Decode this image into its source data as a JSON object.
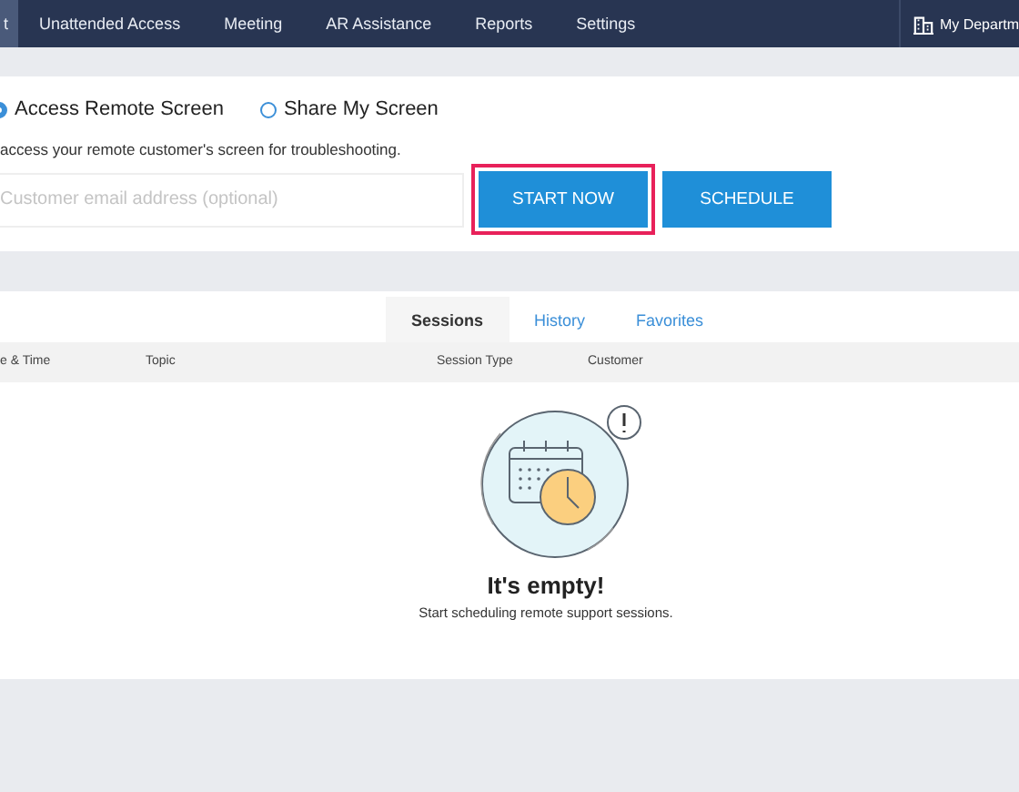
{
  "nav": {
    "items": [
      {
        "label": "t",
        "selected": true
      },
      {
        "label": "Unattended Access",
        "selected": false
      },
      {
        "label": "Meeting",
        "selected": false
      },
      {
        "label": "AR Assistance",
        "selected": false
      },
      {
        "label": "Reports",
        "selected": false
      },
      {
        "label": "Settings",
        "selected": false
      }
    ],
    "department": "My Departm"
  },
  "mode": {
    "options": [
      {
        "label": "Access Remote Screen",
        "selected": true
      },
      {
        "label": "Share My Screen",
        "selected": false
      }
    ],
    "description": "access your remote customer's screen for troubleshooting.",
    "email": {
      "placeholder": "Customer email address (optional)"
    },
    "buttons": [
      {
        "label": "START NOW",
        "highlighted": true
      },
      {
        "label": "SCHEDULE",
        "highlighted": false
      }
    ]
  },
  "tabs": [
    {
      "label": "Sessions",
      "selected": true
    },
    {
      "label": "History",
      "selected": false
    },
    {
      "label": "Favorites",
      "selected": false
    }
  ],
  "table": {
    "columns": [
      "e & Time",
      "Topic",
      "Session Type",
      "Customer"
    ]
  },
  "empty": {
    "title": "It's empty!",
    "message": "Start scheduling remote support sessions."
  }
}
